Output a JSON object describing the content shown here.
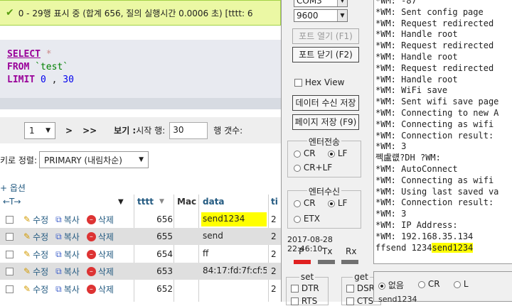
{
  "pma": {
    "banner": "0 - 29행 표시 중 (합계 656, 질의 실행시간 0.0006 초) [tttt: 6",
    "sql": {
      "select": "SELECT",
      "star": "*",
      "from": "FROM",
      "table": "`test`",
      "limit": "LIMIT",
      "offset": "0",
      "comma": ",",
      "count": "30"
    },
    "nav": {
      "page": "1",
      "next": ">",
      "last": ">>",
      "show_label": "보기 :",
      "start_label": "시작 행:",
      "start_value": "30",
      "rows_label": "행 갯수:"
    },
    "sort": {
      "label": "키로 정렬:",
      "value": "PRIMARY (내림차순)"
    },
    "options_label": "+ 옵션",
    "columns": {
      "tttt": "tttt",
      "mac": "Mac",
      "data": "data",
      "extra": "ti"
    },
    "actions": {
      "edit": "수정",
      "copy": "복사",
      "delete": "삭제"
    },
    "rows": [
      {
        "id": "656",
        "data": "send1234",
        "extra": "2"
      },
      {
        "id": "655",
        "data": "send",
        "extra": "2"
      },
      {
        "id": "654",
        "data": "ff",
        "extra": "2"
      },
      {
        "id": "653",
        "data": "84:17:fd:7f:cf:5c",
        "extra": "2"
      },
      {
        "id": "652",
        "data": "",
        "extra": "2"
      }
    ]
  },
  "terminal": {
    "port_value": "COM3",
    "baud_value": "9600",
    "open_port": "포트 열기 (F1)",
    "close_port": "포트 닫기 (F2)",
    "hex_view": "Hex View",
    "save_received": "데이터 수신 저장",
    "save_page": "페이지 저장 (F9)",
    "enter_send": {
      "title": "엔터전송",
      "cr": "CR",
      "lf": "LF",
      "crlf": "CR+LF"
    },
    "enter_recv": {
      "title": "엔터수신",
      "cr": "CR",
      "lf": "LF",
      "etx": "ETX"
    },
    "timestamp": "2017-08-28 22:46:10",
    "leds": {
      "p": "P",
      "tx": "Tx",
      "rx": "Rx"
    },
    "set_title": "set",
    "get_title": "get",
    "dtr": "DTR",
    "rts": "RTS",
    "dsr": "DSR",
    "cts": "CTS",
    "line_end": {
      "none": "없음",
      "cr": "CR",
      "lf": "L"
    },
    "send_input": "send1234",
    "console": [
      "*WM: -87",
      "*WM: Sent config page",
      "*WM: Request redirected",
      "*WM: Handle root",
      "*WM: Request redirected",
      "*WM: Handle root",
      "*WM: Request redirected",
      "*WM: Handle root",
      "*WM: WiFi save",
      "*WM: Sent wifi save page",
      "*WM: Connecting to new A",
      "*WM: Connecting as wifi",
      "*WM: Connection result:",
      "*WM: 3",
      "쩩盧럢?DH ?WM:",
      "*WM: AutoConnect",
      "*WM: Connecting as wifi",
      "*WM: Using last saved va",
      "*WM: Connection result:",
      "*WM: 3",
      "*WM: IP Address:",
      "*WM: 192.168.35.134"
    ],
    "console_last_prefix": "ffsend 1234",
    "console_last_hl": "send1234",
    "colors": {
      "p_led": "#e02020",
      "tx_led": "#707070",
      "rx_led": "#707070",
      "highlight": "#ffff00"
    }
  }
}
